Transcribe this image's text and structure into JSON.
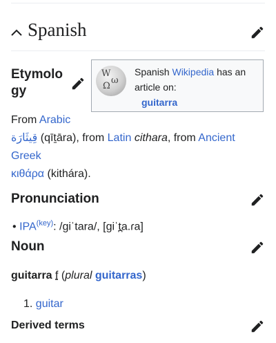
{
  "section": {
    "title": "Spanish"
  },
  "etymology": {
    "heading_line1": "Etymolo",
    "heading_line2": "gy",
    "wikipedia_box": {
      "text_before": "Spanish ",
      "link": "Wikipedia",
      "text_after": " has an",
      "line2": "article on:",
      "article_link": "guitarra"
    },
    "line1_prefix": "From ",
    "line1_link": "Arabic",
    "arabic_link": "قِيثَارَة",
    "translit": " (qīṯāra), from ",
    "latin_link": "Latin",
    "latin_term": "cithara",
    "comma_from": ", from ",
    "greek_link": "Ancient Greek",
    "greek_term_link": "κιθάρα",
    "greek_translit": " (kithára)."
  },
  "pronunciation": {
    "heading": "Pronunciation",
    "ipa_link": "IPA",
    "key_link": "(key)",
    "ipa_text": ": /ɡiˈtara/, [ɡiˈt̪a.ɾa]"
  },
  "noun": {
    "heading": "Noun",
    "headword": "guitarra",
    "gender_abbr": "f",
    "plural_label": "plural",
    "plural_link": "guitarras",
    "open_paren": " (",
    "close_paren": ")",
    "definitions": [
      {
        "number": "1.",
        "link": "guitar"
      }
    ]
  },
  "derived_terms": {
    "heading": "Derived terms"
  },
  "icons": {
    "collapse": "chevron-up-icon",
    "edit": "pencil-icon",
    "wikipedia": "wikipedia-globe-icon"
  },
  "colors": {
    "link": "#3366cc",
    "text": "#202122",
    "divider": "#eaecf0"
  }
}
